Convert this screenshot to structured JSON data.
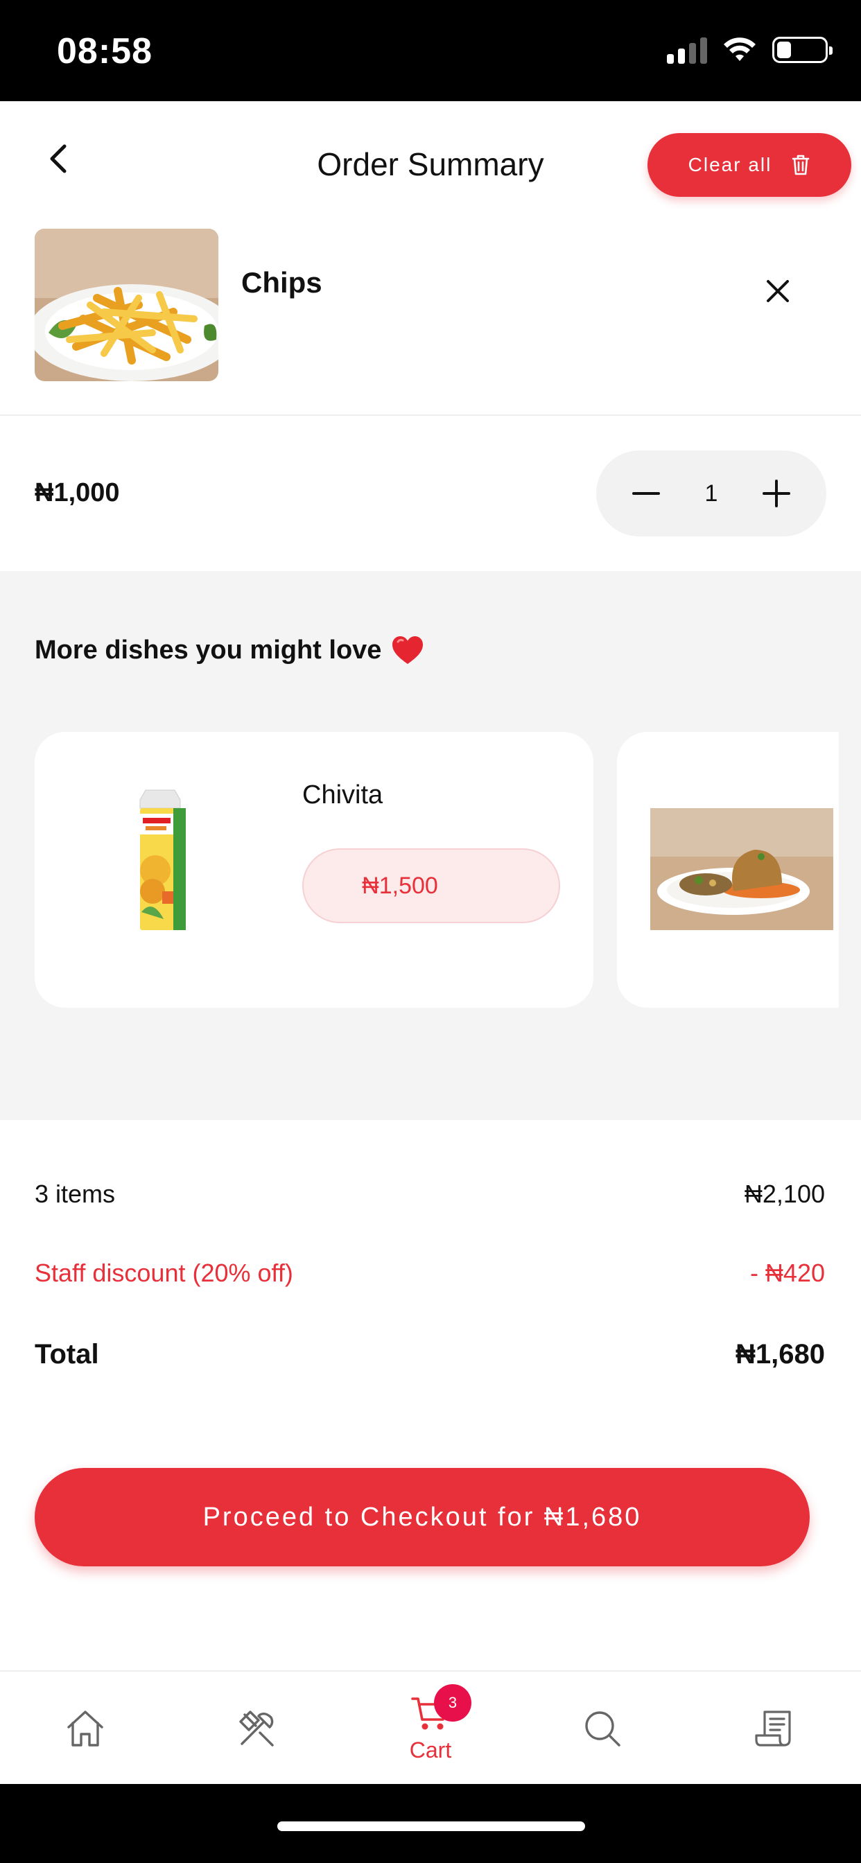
{
  "status_bar": {
    "time": "08:58"
  },
  "header": {
    "title": "Order Summary",
    "clear_label": "Clear all"
  },
  "cart_item": {
    "name": "Chips",
    "price": "₦1,000",
    "quantity": "1"
  },
  "recommendations": {
    "title": "More dishes you might love",
    "items": [
      {
        "name": "Chivita",
        "price": "₦1,500"
      }
    ]
  },
  "summary": {
    "items_label": "3 items",
    "items_value": "₦2,100",
    "discount_label": "Staff discount (20% off)",
    "discount_value": "- ₦420",
    "total_label": "Total",
    "total_value": "₦1,680"
  },
  "checkout": {
    "label": "Proceed to Checkout for ₦1,680"
  },
  "tab_bar": {
    "active": "cart",
    "cart_label": "Cart",
    "cart_badge": "3",
    "icons": [
      "home-icon",
      "utensils-icon",
      "cart-icon",
      "search-icon",
      "receipt-icon"
    ]
  },
  "colors": {
    "accent": "#e8303a",
    "badge": "#e8104a",
    "muted_bg": "#f4f4f4"
  }
}
